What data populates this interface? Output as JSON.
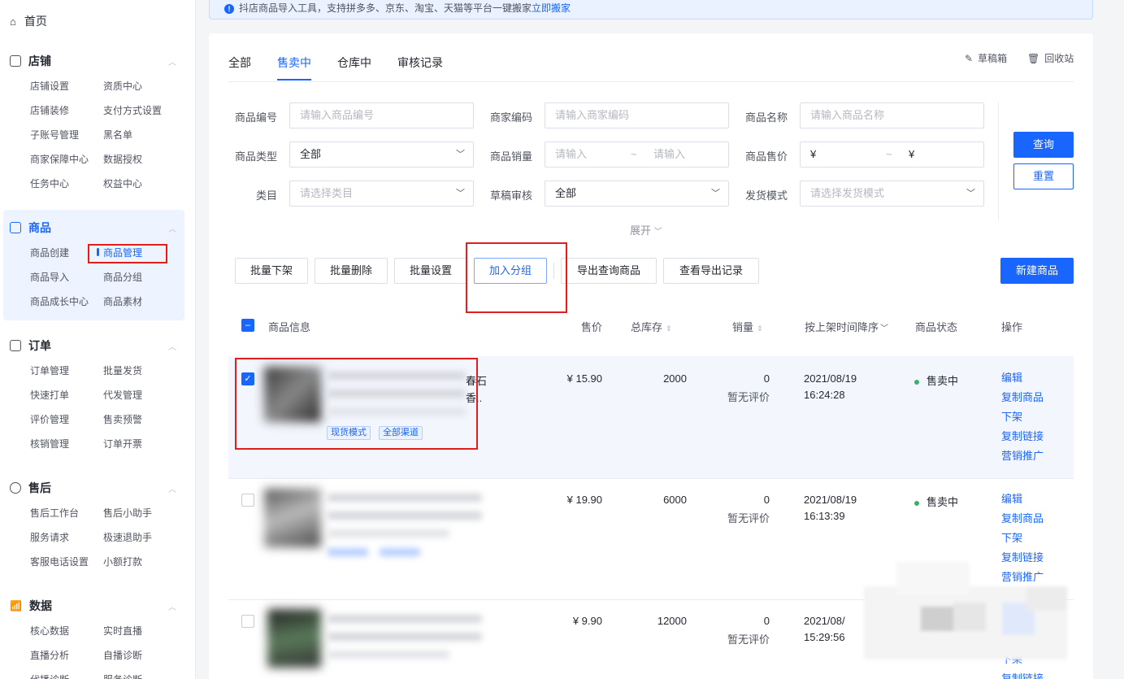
{
  "sidebar": {
    "home": "首页",
    "sections": [
      {
        "title": "店铺",
        "items": [
          "店铺设置",
          "资质中心",
          "店铺装修",
          "支付方式设置",
          "子账号管理",
          "黑名单",
          "商家保障中心",
          "数据授权",
          "任务中心",
          "权益中心"
        ]
      },
      {
        "title": "商品",
        "items": [
          "商品创建",
          "商品管理",
          "商品导入",
          "商品分组",
          "商品成长中心",
          "商品素材"
        ]
      },
      {
        "title": "订单",
        "items": [
          "订单管理",
          "批量发货",
          "快速打单",
          "代发管理",
          "评价管理",
          "售卖预警",
          "核销管理",
          "订单开票"
        ]
      },
      {
        "title": "售后",
        "items": [
          "售后工作台",
          "售后小助手",
          "服务请求",
          "极速退助手",
          "客服电话设置",
          "小额打款"
        ]
      },
      {
        "title": "数据",
        "items": [
          "核心数据",
          "实时直播",
          "直播分析",
          "自播诊断",
          "代播诊断",
          "服务诊断"
        ]
      }
    ]
  },
  "notice": {
    "text": "抖店商品导入工具，支持拼多多、京东、淘宝、天猫等平台一键搬家",
    "link": "立即搬家"
  },
  "tabs": [
    "全部",
    "售卖中",
    "仓库中",
    "审核记录"
  ],
  "toolbar_right": {
    "drafts": "草稿箱",
    "recycle": "回收站"
  },
  "filters": {
    "product_id": {
      "label": "商品编号",
      "placeholder": "请输入商品编号"
    },
    "merchant_code": {
      "label": "商家编码",
      "placeholder": "请输入商家编码"
    },
    "product_name": {
      "label": "商品名称",
      "placeholder": "请输入商品名称"
    },
    "product_type": {
      "label": "商品类型",
      "value": "全部"
    },
    "sales": {
      "label": "商品销量",
      "min_placeholder": "请输入",
      "sep": "~",
      "max_placeholder": "请输入"
    },
    "price": {
      "label": "商品售价",
      "min_prefix": "¥",
      "sep": "~",
      "max_prefix": "¥"
    },
    "category": {
      "label": "类目",
      "placeholder": "请选择类目"
    },
    "draft_review": {
      "label": "草稿审核",
      "value": "全部"
    },
    "shipping_mode": {
      "label": "发货模式",
      "placeholder": "请选择发货模式"
    },
    "expand": "展开",
    "query_btn": "查询",
    "reset_btn": "重置"
  },
  "actions": {
    "batch_offshelf": "批量下架",
    "batch_delete": "批量删除",
    "batch_settings": "批量设置",
    "add_group": "加入分组",
    "export_query": "导出查询商品",
    "view_export": "查看导出记录",
    "new_product": "新建商品"
  },
  "table": {
    "headers": {
      "info": "商品信息",
      "price": "售价",
      "stock": "总库存",
      "sales": "销量",
      "time": "按上架时间降序",
      "status": "商品状态",
      "ops": "操作"
    },
    "rows": [
      {
        "checked": true,
        "title_tail_1": "春石",
        "title_tail_2": "香..",
        "tags": [
          "现货模式",
          "全部渠道"
        ],
        "price": "¥ 15.90",
        "stock": "2000",
        "sales": "0",
        "rating": "暂无评价",
        "date": "2021/08/19",
        "time": "16:24:28",
        "status": "售卖中",
        "ops": [
          "编辑",
          "复制商品",
          "下架",
          "复制链接",
          "营销推广"
        ]
      },
      {
        "checked": false,
        "price": "¥ 19.90",
        "stock": "6000",
        "sales": "0",
        "rating": "暂无评价",
        "date": "2021/08/19",
        "time": "16:13:39",
        "status": "售卖中",
        "ops": [
          "编辑",
          "复制商品",
          "下架",
          "复制链接",
          "营销推广"
        ]
      },
      {
        "checked": false,
        "price": "¥ 9.90",
        "stock": "12000",
        "sales": "0",
        "rating": "暂无评价",
        "date": "2021/08/",
        "time": "15:29:56",
        "ops": [
          "下架",
          "复制链接"
        ]
      }
    ]
  },
  "colors": {
    "accent": "#1966ff",
    "annotation": "#e21d1d",
    "status_green": "#35b36b"
  }
}
